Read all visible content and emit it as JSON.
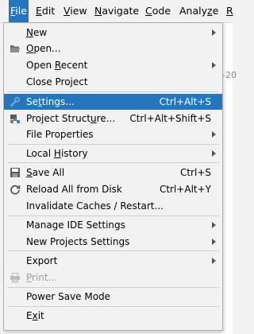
{
  "menubar": {
    "items": [
      {
        "label": "File",
        "mnemonic": "F",
        "rest": "ile"
      },
      {
        "label": "Edit",
        "mnemonic": "E",
        "rest": "dit"
      },
      {
        "label": "View",
        "mnemonic": "V",
        "rest": "iew"
      },
      {
        "label": "Navigate",
        "mnemonic": "N",
        "rest": "avigate"
      },
      {
        "label": "Code",
        "mnemonic": "C",
        "rest": "ode"
      },
      {
        "label": "Analyze",
        "pre": "Analy",
        "mnemonic": "z",
        "rest": "e"
      },
      {
        "label": "R",
        "mnemonic": "R",
        "rest": ""
      }
    ]
  },
  "background": {
    "partial_text": "-20"
  },
  "file_menu": {
    "new": {
      "label": "New",
      "mnemonic": "N",
      "rest": "ew"
    },
    "open": {
      "label": "Open...",
      "mnemonic": "O",
      "rest": "pen..."
    },
    "open_recent": {
      "label": "Open Recent",
      "pre": "Open ",
      "mnemonic": "R",
      "rest": "ecent"
    },
    "close_project": {
      "label": "Close Project",
      "mnemonic": "",
      "rest": "Close Project"
    },
    "settings": {
      "label": "Settings...",
      "pre": "Se",
      "mnemonic": "t",
      "rest": "tings...",
      "shortcut": "Ctrl+Alt+S"
    },
    "project_structure": {
      "label": "Project Structure...",
      "pre": "Project Struct",
      "mnemonic": "u",
      "rest": "re...",
      "shortcut": "Ctrl+Alt+Shift+S"
    },
    "file_properties": {
      "label": "File Properties",
      "mnemonic": "",
      "rest": "File Properties"
    },
    "local_history": {
      "label": "Local History",
      "pre": "Local ",
      "mnemonic": "H",
      "rest": "istory"
    },
    "save_all": {
      "label": "Save All",
      "mnemonic": "S",
      "rest": "ave All",
      "shortcut": "Ctrl+S"
    },
    "reload_all": {
      "label": "Reload All from Disk",
      "mnemonic": "",
      "rest": "Reload All from Disk",
      "shortcut": "Ctrl+Alt+Y"
    },
    "invalidate_caches": {
      "label": "Invalidate Caches / Restart...",
      "mnemonic": "",
      "rest": "Invalidate Caches / Restart..."
    },
    "manage_ide_settings": {
      "label": "Manage IDE Settings",
      "mnemonic": "",
      "rest": "Manage IDE Settings"
    },
    "new_projects_settings": {
      "label": "New Projects Settings",
      "mnemonic": "",
      "rest": "New Projects Settings"
    },
    "export": {
      "label": "Export",
      "mnemonic": "",
      "rest": "Export"
    },
    "print": {
      "label": "Print...",
      "mnemonic": "P",
      "rest": "rint..."
    },
    "power_save_mode": {
      "label": "Power Save Mode",
      "mnemonic": "",
      "rest": "Power Save Mode"
    },
    "exit": {
      "label": "Exit",
      "pre": "E",
      "mnemonic": "x",
      "rest": "it"
    }
  },
  "colors": {
    "selection": "#2675bf",
    "menu_bg": "#f2f2f2",
    "disabled": "#a0a0a0"
  }
}
